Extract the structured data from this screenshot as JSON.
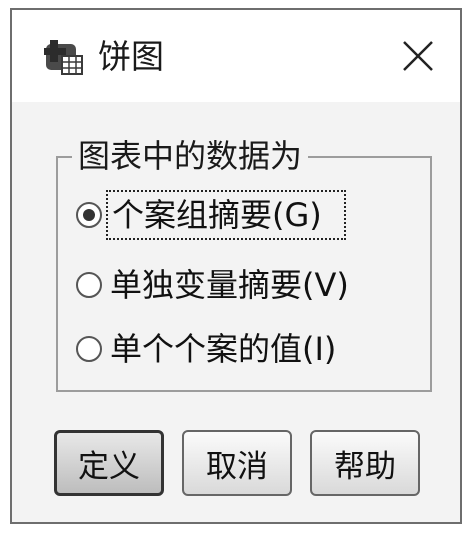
{
  "window": {
    "title": "饼图",
    "icon": "pie-chart-app-icon",
    "close_icon": "close-icon"
  },
  "group": {
    "legend": "图表中的数据为",
    "options": [
      {
        "label": "个案组摘要(G)",
        "selected": true,
        "focused": true
      },
      {
        "label": "单独变量摘要(V)",
        "selected": false,
        "focused": false
      },
      {
        "label": "单个个案的值(I)",
        "selected": false,
        "focused": false
      }
    ]
  },
  "buttons": {
    "define_label": "定义",
    "cancel_label": "取消",
    "help_label": "帮助"
  }
}
